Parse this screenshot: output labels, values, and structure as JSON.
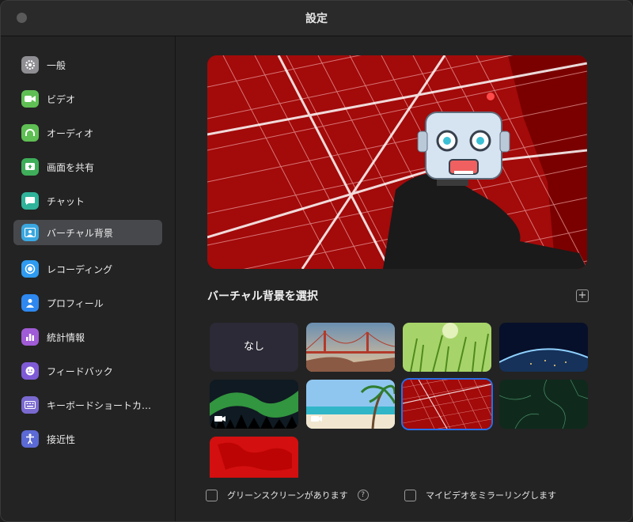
{
  "window": {
    "title": "設定"
  },
  "sidebar": {
    "items": [
      {
        "label": "一般",
        "icon": "gear-icon",
        "color": "#8e8e93"
      },
      {
        "label": "ビデオ",
        "icon": "video-camera-icon",
        "color": "#5fbf54"
      },
      {
        "label": "オーディオ",
        "icon": "headphones-icon",
        "color": "#5fbf54"
      },
      {
        "label": "画面を共有",
        "icon": "share-screen-icon",
        "color": "#3fae5a"
      },
      {
        "label": "チャット",
        "icon": "chat-bubble-icon",
        "color": "#2fb39a"
      },
      {
        "label": "バーチャル背景",
        "icon": "virtual-background-icon",
        "color": "#3aa7e0",
        "active": true
      },
      {
        "label": "レコーディング",
        "icon": "record-icon",
        "color": "#2e9bf0"
      },
      {
        "label": "プロフィール",
        "icon": "profile-icon",
        "color": "#2e88f0"
      },
      {
        "label": "統計情報",
        "icon": "statistics-icon",
        "color": "#a05bd6"
      },
      {
        "label": "フィードバック",
        "icon": "feedback-smile-icon",
        "color": "#7e5ad6"
      },
      {
        "label": "キーボードショートカ…",
        "icon": "keyboard-icon",
        "color": "#7a6ad0"
      },
      {
        "label": "接近性",
        "icon": "accessibility-icon",
        "color": "#5b6ad4"
      }
    ]
  },
  "main": {
    "section_title": "バーチャル背景を選択",
    "add_label": "+",
    "backgrounds": [
      {
        "label": "なし"
      },
      {
        "label": ""
      },
      {
        "label": ""
      },
      {
        "label": ""
      },
      {
        "label": ""
      },
      {
        "label": ""
      },
      {
        "label": ""
      },
      {
        "label": ""
      },
      {
        "label": ""
      }
    ],
    "selected_index": 6,
    "greenscreen_label": "グリーンスクリーンがあります",
    "help_label": "?",
    "mirror_label": "マイビデオをミラーリングします"
  }
}
